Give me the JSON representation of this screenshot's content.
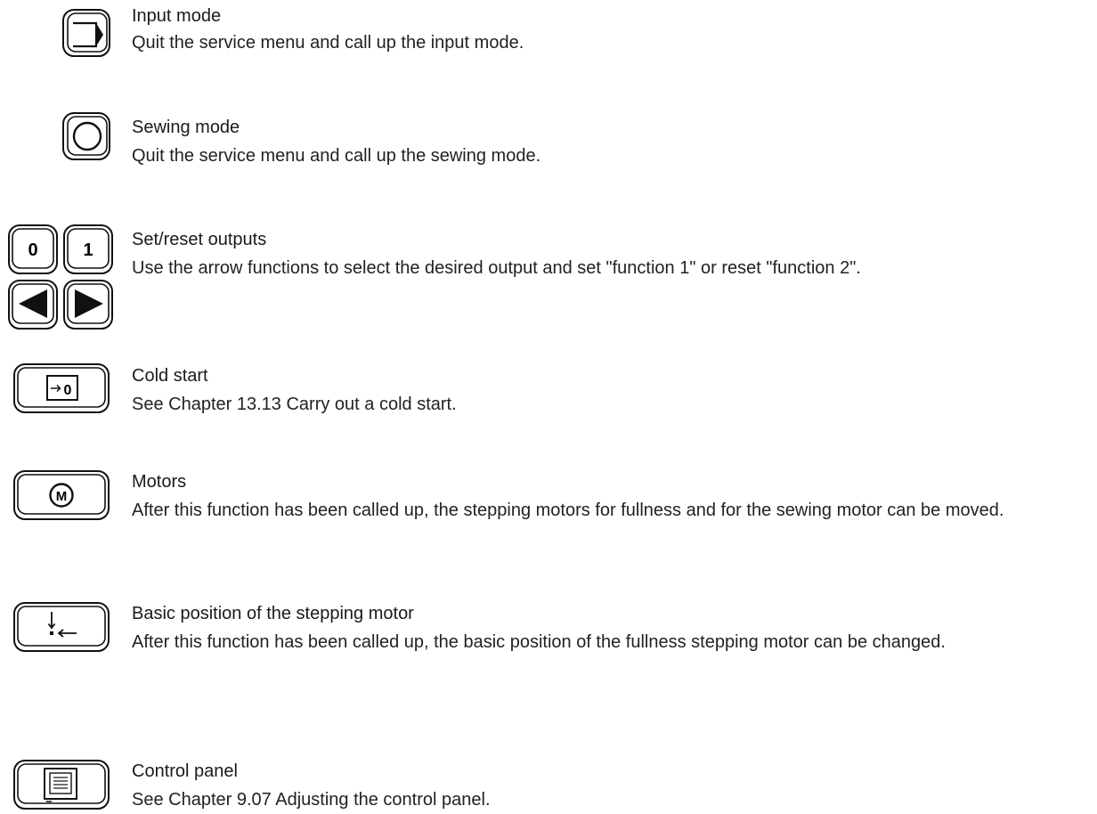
{
  "entries": [
    {
      "title": "Input mode",
      "description": "Quit the service menu and call up the input mode.",
      "icon": "input-mode-icon"
    },
    {
      "title": "Sewing mode",
      "description": "Quit the service menu and call up the sewing mode.",
      "icon": "sewing-mode-icon"
    },
    {
      "title": "Set/reset outputs",
      "description": "Use the arrow functions to select the desired output and set \"function 1\" or reset \"function 2\".",
      "keys": {
        "zero": "0",
        "one": "1"
      },
      "icon": "output-keys-icon"
    },
    {
      "title": "Cold start",
      "description_prefix": "See ",
      "description_ref": "Chapter 13.13 Carry out a cold start.",
      "key_label": "0",
      "icon": "cold-start-icon"
    },
    {
      "title": "Motors",
      "description": "After this function has been called up, the stepping motors for fullness and for the sewing motor can be moved.",
      "key_label": "M",
      "icon": "motors-icon"
    },
    {
      "title": "Basic position of the stepping motor",
      "description": "After this function has been called up, the basic position of the fullness stepping motor can be changed.",
      "icon": "basic-position-icon"
    },
    {
      "title": "Control panel",
      "description_prefix": "See ",
      "description_ref": "Chapter 9.07 Adjusting the control panel.",
      "icon": "control-panel-icon"
    }
  ]
}
